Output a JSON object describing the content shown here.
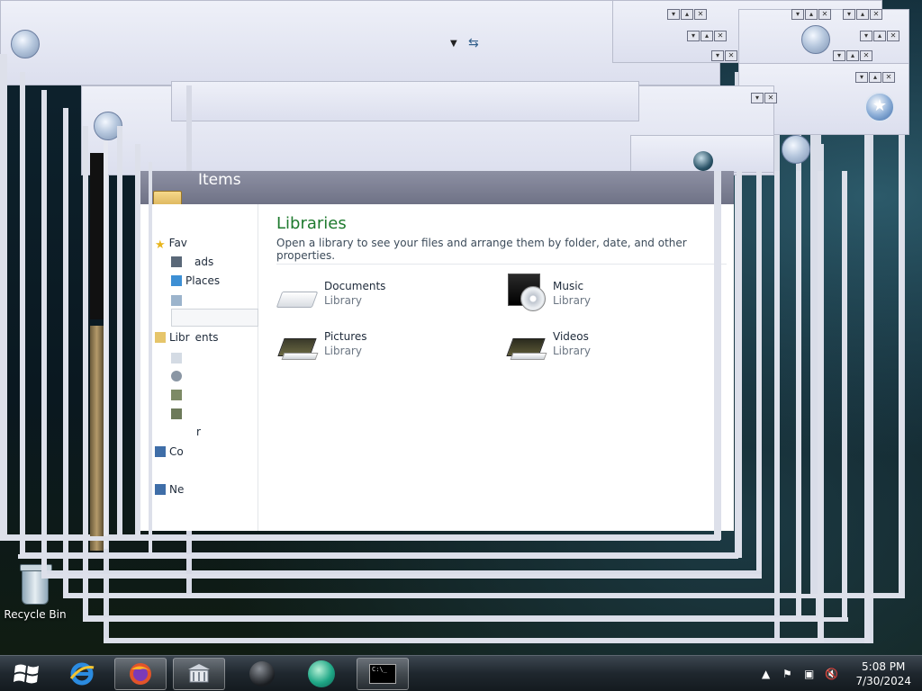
{
  "explorer": {
    "header_title": "Items",
    "nav": {
      "favorites": "Fav",
      "downloads": "ads",
      "recent_places": "Places",
      "libraries": "Libr",
      "libraries_tail": "ents",
      "computer": "Co",
      "network": "Ne",
      "homegroup_tail": "r"
    },
    "libraries": {
      "title": "Libraries",
      "description": "Open a library to see your files and arrange them by folder, date, and other properties.",
      "items": [
        {
          "name": "Documents",
          "type": "Library",
          "icon": "documents-library-icon"
        },
        {
          "name": "Music",
          "type": "Library",
          "icon": "music-library-icon"
        },
        {
          "name": "Pictures",
          "type": "Library",
          "icon": "pictures-library-icon"
        },
        {
          "name": "Videos",
          "type": "Library",
          "icon": "videos-library-icon"
        }
      ]
    }
  },
  "desktop": {
    "recycle_bin_label": "Recycle Bin"
  },
  "taskbar": {
    "time": "5:08 PM",
    "date": "7/30/2024",
    "items": [
      "start-button",
      "internet-explorer",
      "firefox",
      "file-explorer",
      "app-orb",
      "app-globe",
      "command-prompt"
    ]
  }
}
